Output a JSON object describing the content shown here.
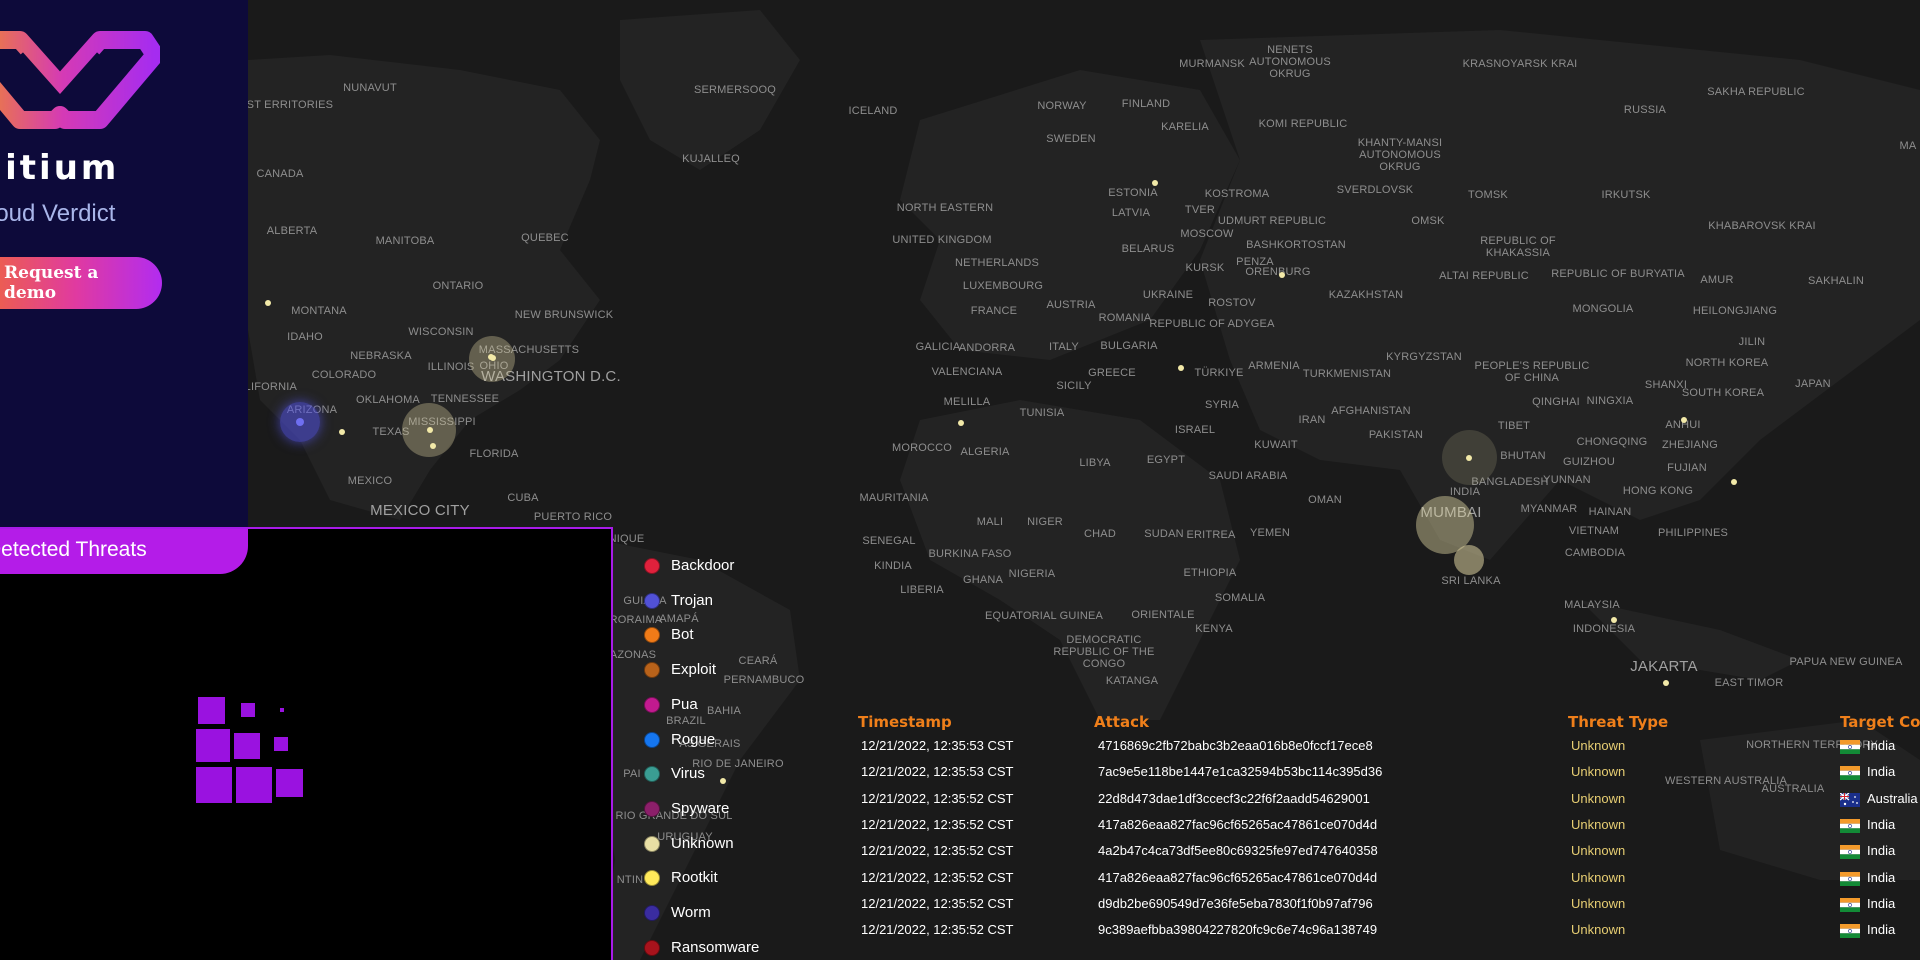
{
  "brand": {
    "logo_text": "citium",
    "subtitle": "loud Verdict",
    "demo_button": "Request a demo",
    "logo_colors": [
      "#f08a2a",
      "#d53ab5",
      "#a52cf0"
    ]
  },
  "threats_panel": {
    "title": "Detected Threats",
    "accent_color": "#b41ce8"
  },
  "map": {
    "background": "#1c1c1c",
    "labels": [
      {
        "text": "NUNAVUT"
      },
      {
        "text": "SERMERSOOQ"
      },
      {
        "text": "ICELAND"
      },
      {
        "text": "NORWAY"
      },
      {
        "text": "FINLAND"
      },
      {
        "text": "MURMANSK"
      },
      {
        "text": "NENETS AUTONOMOUS OKRUG"
      },
      {
        "text": "KRASNOYARSK KRAI"
      },
      {
        "text": "SAKHA REPUBLIC"
      },
      {
        "text": "RUSSIA"
      },
      {
        "text": "KARELIA"
      },
      {
        "text": "KOMI REPUBLIC"
      },
      {
        "text": "SWEDEN"
      },
      {
        "text": "KUJALLEQ"
      },
      {
        "text": "CANADA"
      },
      {
        "text": "ESTONIA"
      },
      {
        "text": "KHANTY-MANSI AUTONOMOUS OKRUG"
      },
      {
        "text": "LATVIA"
      },
      {
        "text": "TVER"
      },
      {
        "text": "KOSTROMA"
      },
      {
        "text": "SVERDLOVSK"
      },
      {
        "text": "TOMSK"
      },
      {
        "text": "IRKUTSK"
      },
      {
        "text": "NORTH EASTERN"
      },
      {
        "text": "UDMURT REPUBLIC"
      },
      {
        "text": "OMSK"
      },
      {
        "text": "KHABAROVSK KRAI"
      },
      {
        "text": "ALBERTA"
      },
      {
        "text": "MANITOBA"
      },
      {
        "text": "QUEBEC"
      },
      {
        "text": "UNITED KINGDOM"
      },
      {
        "text": "BELARUS"
      },
      {
        "text": "MOSCOW"
      },
      {
        "text": "BASHKORTOSTAN"
      },
      {
        "text": "REPUBLIC OF KHAKASSIA"
      },
      {
        "text": "NETHERLANDS"
      },
      {
        "text": "KURSK"
      },
      {
        "text": "PENZA"
      },
      {
        "text": "ORENBURG"
      },
      {
        "text": "ALTAI REPUBLIC"
      },
      {
        "text": "REPUBLIC OF BURYATIA"
      },
      {
        "text": "AMUR"
      },
      {
        "text": "SAKHALIN"
      },
      {
        "text": "LUXEMBOURG"
      },
      {
        "text": "UKRAINE"
      },
      {
        "text": "KAZAKHSTAN"
      },
      {
        "text": "ONTARIO"
      },
      {
        "text": "FRANCE"
      },
      {
        "text": "AUSTRIA"
      },
      {
        "text": "ROSTOV"
      },
      {
        "text": "MONGOLIA"
      },
      {
        "text": "HEILONGJIANG"
      },
      {
        "text": "MONTANA"
      },
      {
        "text": "NEW BRUNSWICK"
      },
      {
        "text": "ROMANIA"
      },
      {
        "text": "REPUBLIC OF ADYGEA"
      },
      {
        "text": "JILIN"
      },
      {
        "text": "IDAHO"
      },
      {
        "text": "WISCONSIN"
      },
      {
        "text": "GALICIA"
      },
      {
        "text": "ANDORRA"
      },
      {
        "text": "ITALY"
      },
      {
        "text": "BULGARIA"
      },
      {
        "text": "KYRGYZSTAN"
      },
      {
        "text": "NEBRASKA"
      },
      {
        "text": "MASSACHUSETTS"
      },
      {
        "text": "NORTH KOREA"
      },
      {
        "text": "ILLINOIS"
      },
      {
        "text": "OHIO"
      },
      {
        "text": "VALENCIANA"
      },
      {
        "text": "GREECE"
      },
      {
        "text": "TÜRKIYE"
      },
      {
        "text": "ARMENIA"
      },
      {
        "text": "TURKMENISTAN"
      },
      {
        "text": "PEOPLE'S REPUBLIC OF CHINA"
      },
      {
        "text": "COLORADO"
      },
      {
        "text": "WASHINGTON D.C."
      },
      {
        "text": "SICILY"
      },
      {
        "text": "SHANXI"
      },
      {
        "text": "SOUTH KOREA"
      },
      {
        "text": "JAPAN"
      },
      {
        "text": "CALIFORNIA"
      },
      {
        "text": "OKLAHOMA"
      },
      {
        "text": "TENNESSEE"
      },
      {
        "text": "MELILLA"
      },
      {
        "text": "TUNISIA"
      },
      {
        "text": "SYRIA"
      },
      {
        "text": "AFGHANISTAN"
      },
      {
        "text": "QINGHAI"
      },
      {
        "text": "NINGXIA"
      },
      {
        "text": "ARIZONA"
      },
      {
        "text": "MISSISSIPPI"
      },
      {
        "text": "IRAN"
      },
      {
        "text": "PAKISTAN"
      },
      {
        "text": "TIBET"
      },
      {
        "text": "ANHUI"
      },
      {
        "text": "TEXAS"
      },
      {
        "text": "ISRAEL"
      },
      {
        "text": "CHONGQING"
      },
      {
        "text": "ZHEJIANG"
      },
      {
        "text": "MOROCCO"
      },
      {
        "text": "ALGERIA"
      },
      {
        "text": "KUWAIT"
      },
      {
        "text": "BHUTAN"
      },
      {
        "text": "FLORIDA"
      },
      {
        "text": "LIBYA"
      },
      {
        "text": "EGYPT"
      },
      {
        "text": "GUIZHOU"
      },
      {
        "text": "FUJIAN"
      },
      {
        "text": "SAUDI ARABIA"
      },
      {
        "text": "BANGLADESH"
      },
      {
        "text": "YUNNAN"
      },
      {
        "text": "MEXICO"
      },
      {
        "text": "INDIA"
      },
      {
        "text": "HONG KONG"
      },
      {
        "text": "OMAN"
      },
      {
        "text": "CUBA"
      },
      {
        "text": "MAURITANIA"
      },
      {
        "text": "MEXICO CITY"
      },
      {
        "text": "MUMBAI"
      },
      {
        "text": "MYANMAR"
      },
      {
        "text": "HAINAN"
      },
      {
        "text": "PUERTO RICO"
      },
      {
        "text": "MALI"
      },
      {
        "text": "NIGER"
      },
      {
        "text": "CHAD"
      },
      {
        "text": "SUDAN"
      },
      {
        "text": "ERITREA"
      },
      {
        "text": "YEMEN"
      },
      {
        "text": "VIETNAM"
      },
      {
        "text": "PHILIPPINES"
      },
      {
        "text": "MARTINIQUE"
      },
      {
        "text": "SENEGAL"
      },
      {
        "text": "BURKINA FASO"
      },
      {
        "text": "CAMBODIA"
      },
      {
        "text": "KINDIA"
      },
      {
        "text": "NIGERIA"
      },
      {
        "text": "ETHIOPIA"
      },
      {
        "text": "GHANA"
      },
      {
        "text": "SRI LANKA"
      },
      {
        "text": "LIBERIA"
      },
      {
        "text": "GUIANA"
      },
      {
        "text": "SOMALIA"
      },
      {
        "text": "MALAYSIA"
      },
      {
        "text": "EQUATORIAL GUINEA"
      },
      {
        "text": "ORIENTALE"
      },
      {
        "text": "RORAIMA"
      },
      {
        "text": "AMAPÁ"
      },
      {
        "text": "INDONESIA"
      },
      {
        "text": "KENYA"
      },
      {
        "text": "AZONAS"
      },
      {
        "text": "DEMOCRATIC REPUBLIC OF THE CONGO"
      },
      {
        "text": "PAPUA NEW GUINEA"
      },
      {
        "text": "CEARÁ"
      },
      {
        "text": "JAKARTA"
      },
      {
        "text": "EAST TIMOR"
      },
      {
        "text": "PERNAMBUCO"
      },
      {
        "text": "KATANGA"
      },
      {
        "text": "BAHIA"
      },
      {
        "text": "BRAZIL"
      },
      {
        "text": "AS GERAIS"
      },
      {
        "text": "RIO DE JANEIRO"
      },
      {
        "text": "PAI"
      },
      {
        "text": "RIO GRANDE DO SUL"
      },
      {
        "text": "URUGUAY"
      },
      {
        "text": "NTIN"
      },
      {
        "text": "ORTHWEST ERRITORIES"
      },
      {
        "text": "NORTHERN TERRITORY"
      },
      {
        "text": "WESTERN AUSTRALIA"
      },
      {
        "text": "AUSTRALIA"
      },
      {
        "text": "MA"
      }
    ]
  },
  "legend": [
    {
      "label": "Backdoor",
      "color": "#e0213c"
    },
    {
      "label": "Trojan",
      "color": "#5151d6"
    },
    {
      "label": "Bot",
      "color": "#f07b18"
    },
    {
      "label": "Exploit",
      "color": "#b8621a"
    },
    {
      "label": "Pua",
      "color": "#c21a8f"
    },
    {
      "label": "Rogue",
      "color": "#1576f0"
    },
    {
      "label": "Virus",
      "color": "#3a9d93"
    },
    {
      "label": "Spyware",
      "color": "#8c1f6a"
    },
    {
      "label": "Unknown",
      "color": "#e8dfa4"
    },
    {
      "label": "Rootkit",
      "color": "#ffe95a"
    },
    {
      "label": "Worm",
      "color": "#3a2ca0"
    },
    {
      "label": "Ransomware",
      "color": "#a8131c"
    }
  ],
  "table": {
    "headers": [
      "Timestamp",
      "Attack",
      "Threat Type",
      "Target Co"
    ],
    "rows": [
      {
        "timestamp": "12/21/2022, 12:35:53 CST",
        "attack": "4716869c2fb72babc3b2eaa016b8e0fccf17ece8",
        "type": "Unknown",
        "country": "India",
        "flag": "india"
      },
      {
        "timestamp": "12/21/2022, 12:35:53 CST",
        "attack": "7ac9e5e118be1447e1ca32594b53bc114c395d36",
        "type": "Unknown",
        "country": "India",
        "flag": "india"
      },
      {
        "timestamp": "12/21/2022, 12:35:52 CST",
        "attack": "22d8d473dae1df3ccecf3c22f6f2aadd54629001",
        "type": "Unknown",
        "country": "Australia",
        "flag": "australia"
      },
      {
        "timestamp": "12/21/2022, 12:35:52 CST",
        "attack": "417a826eaa827fac96cf65265ac47861ce070d4d",
        "type": "Unknown",
        "country": "India",
        "flag": "india"
      },
      {
        "timestamp": "12/21/2022, 12:35:52 CST",
        "attack": "4a2b47c4ca73df5ee80c69325fe97ed747640358",
        "type": "Unknown",
        "country": "India",
        "flag": "india"
      },
      {
        "timestamp": "12/21/2022, 12:35:52 CST",
        "attack": "417a826eaa827fac96cf65265ac47861ce070d4d",
        "type": "Unknown",
        "country": "India",
        "flag": "india"
      },
      {
        "timestamp": "12/21/2022, 12:35:52 CST",
        "attack": "d9db2be690549d7e36fe5eba7830f1f0b97af796",
        "type": "Unknown",
        "country": "India",
        "flag": "india"
      },
      {
        "timestamp": "12/21/2022, 12:35:52 CST",
        "attack": "9c389aefbba39804227820fc9c6e74c96a138749",
        "type": "Unknown",
        "country": "India",
        "flag": "india"
      }
    ]
  }
}
